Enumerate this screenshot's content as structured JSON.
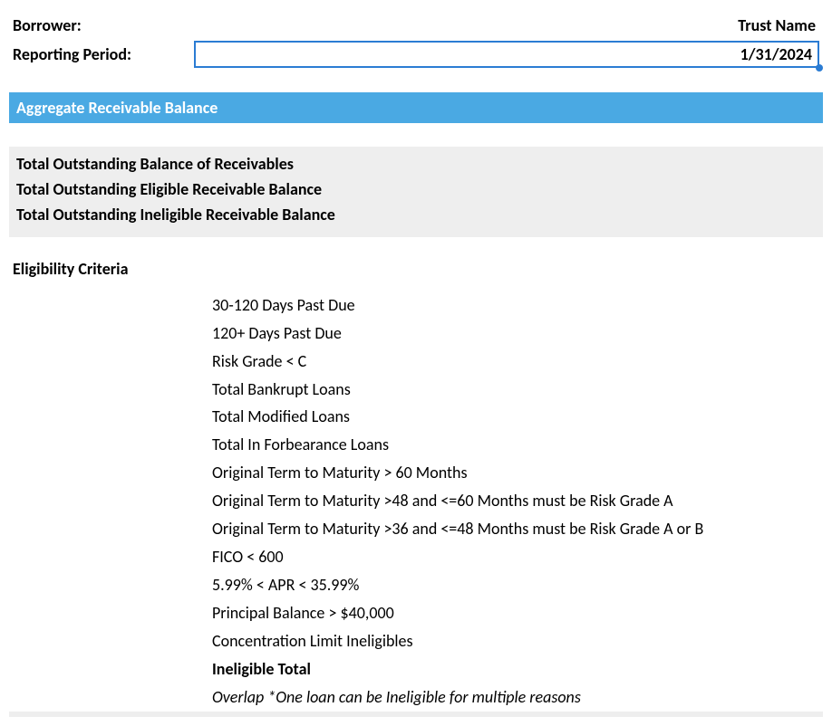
{
  "header": {
    "borrower_label": "Borrower:",
    "borrower_value": "Trust Name",
    "reporting_period_label": "Reporting Period:",
    "reporting_period_value": "1/31/2024"
  },
  "section_title": "Aggregate Receivable Balance",
  "totals": {
    "line1": "Total Outstanding Balance of Receivables",
    "line2": "Total Outstanding Eligible Receivable Balance",
    "line3": "Total Outstanding Ineligible Receivable Balance"
  },
  "eligibility_header": "Eligibility Criteria",
  "criteria": {
    "c1": "30-120 Days Past Due",
    "c2": "120+ Days Past Due",
    "c3": "Risk Grade < C",
    "c4": "Total Bankrupt Loans",
    "c5": "Total Modified Loans",
    "c6": "Total In Forbearance Loans",
    "c7": "Original Term to Maturity > 60 Months",
    "c8": "Original Term to Maturity >48 and <=60 Months must be Risk Grade A",
    "c9": "Original Term to Maturity >36 and <=48 Months must be Risk Grade A or B",
    "c10": "FICO < 600",
    "c11": "5.99% < APR < 35.99%",
    "c12": "Principal Balance > $40,000",
    "c13": "Concentration Limit Ineligibles",
    "c14": "Ineligible Total",
    "c15": "Overlap *One loan can be Ineligible for multiple reasons"
  }
}
